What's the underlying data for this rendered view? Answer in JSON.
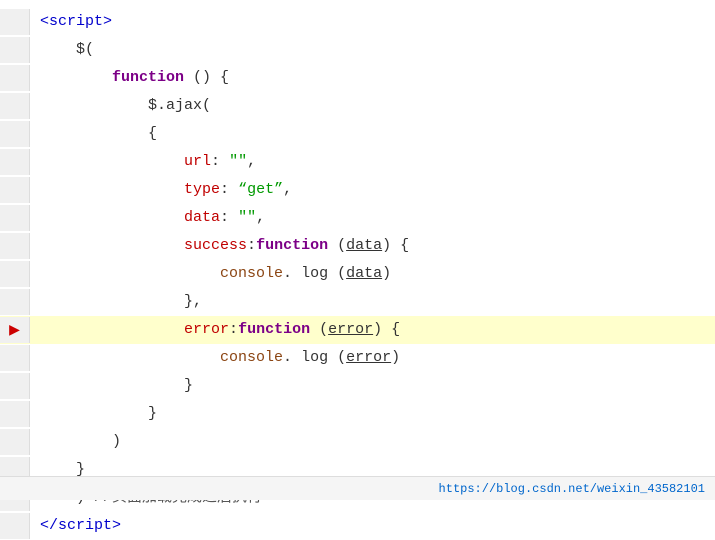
{
  "code": {
    "lines": [
      {
        "id": 1,
        "gutter": "",
        "highlighted": false,
        "parts": [
          {
            "text": "<",
            "class": "tag-bracket"
          },
          {
            "text": "script",
            "class": "tag"
          },
          {
            "text": ">",
            "class": "tag-bracket"
          }
        ]
      },
      {
        "id": 2,
        "gutter": "",
        "highlighted": false,
        "parts": [
          {
            "text": "    $(",
            "class": "plain"
          }
        ]
      },
      {
        "id": 3,
        "gutter": "",
        "highlighted": false,
        "parts": [
          {
            "text": "        ",
            "class": "plain"
          },
          {
            "text": "function",
            "class": "func-kw"
          },
          {
            "text": " () {",
            "class": "plain"
          }
        ]
      },
      {
        "id": 4,
        "gutter": "",
        "highlighted": false,
        "parts": [
          {
            "text": "            $.ajax(",
            "class": "plain"
          }
        ]
      },
      {
        "id": 5,
        "gutter": "",
        "highlighted": false,
        "parts": [
          {
            "text": "            {",
            "class": "plain"
          }
        ]
      },
      {
        "id": 6,
        "gutter": "",
        "highlighted": false,
        "parts": [
          {
            "text": "                ",
            "class": "plain"
          },
          {
            "text": "url",
            "class": "prop"
          },
          {
            "text": ": ",
            "class": "plain"
          },
          {
            "text": "\"\"",
            "class": "str-green"
          },
          {
            "text": ",",
            "class": "plain"
          }
        ]
      },
      {
        "id": 7,
        "gutter": "",
        "highlighted": false,
        "parts": [
          {
            "text": "                ",
            "class": "plain"
          },
          {
            "text": "type",
            "class": "prop"
          },
          {
            "text": ": ",
            "class": "plain"
          },
          {
            "text": "“get”",
            "class": "str-green"
          },
          {
            "text": ",",
            "class": "plain"
          }
        ]
      },
      {
        "id": 8,
        "gutter": "",
        "highlighted": false,
        "parts": [
          {
            "text": "                ",
            "class": "plain"
          },
          {
            "text": "data",
            "class": "prop"
          },
          {
            "text": ": ",
            "class": "plain"
          },
          {
            "text": "\"\"",
            "class": "str-green"
          },
          {
            "text": ",",
            "class": "plain"
          }
        ]
      },
      {
        "id": 9,
        "gutter": "",
        "highlighted": false,
        "parts": [
          {
            "text": "                ",
            "class": "plain"
          },
          {
            "text": "success",
            "class": "prop"
          },
          {
            "text": ":",
            "class": "plain"
          },
          {
            "text": "function",
            "class": "func-kw"
          },
          {
            "text": " (",
            "class": "plain"
          },
          {
            "text": "data",
            "class": "param-underline"
          },
          {
            "text": ") {",
            "class": "plain"
          }
        ]
      },
      {
        "id": 10,
        "gutter": "",
        "highlighted": false,
        "parts": [
          {
            "text": "                    ",
            "class": "plain"
          },
          {
            "text": "console",
            "class": "console-text"
          },
          {
            "text": ".",
            "class": "plain"
          },
          {
            "text": " log",
            "class": "plain"
          },
          {
            "text": " (",
            "class": "plain"
          },
          {
            "text": "data",
            "class": "param-underline"
          },
          {
            "text": ")",
            "class": "plain"
          }
        ]
      },
      {
        "id": 11,
        "gutter": "",
        "highlighted": false,
        "parts": [
          {
            "text": "                },",
            "class": "plain"
          }
        ]
      },
      {
        "id": 12,
        "gutter": "arrow",
        "highlighted": true,
        "parts": [
          {
            "text": "                ",
            "class": "plain"
          },
          {
            "text": "error",
            "class": "prop"
          },
          {
            "text": ":",
            "class": "plain"
          },
          {
            "text": "function",
            "class": "func-kw"
          },
          {
            "text": " (",
            "class": "plain"
          },
          {
            "text": "error",
            "class": "param-underline"
          },
          {
            "text": ") {",
            "class": "plain"
          }
        ]
      },
      {
        "id": 13,
        "gutter": "",
        "highlighted": false,
        "parts": [
          {
            "text": "                    ",
            "class": "plain"
          },
          {
            "text": "console",
            "class": "console-text"
          },
          {
            "text": ".",
            "class": "plain"
          },
          {
            "text": " log",
            "class": "plain"
          },
          {
            "text": " (",
            "class": "plain"
          },
          {
            "text": "error",
            "class": "param-underline"
          },
          {
            "text": ")",
            "class": "plain"
          }
        ]
      },
      {
        "id": 14,
        "gutter": "",
        "highlighted": false,
        "parts": [
          {
            "text": "                }",
            "class": "plain"
          }
        ]
      },
      {
        "id": 15,
        "gutter": "",
        "highlighted": false,
        "parts": [
          {
            "text": "            }",
            "class": "plain"
          }
        ]
      },
      {
        "id": 16,
        "gutter": "",
        "highlighted": false,
        "parts": [
          {
            "text": "        )",
            "class": "plain"
          }
        ]
      },
      {
        "id": 17,
        "gutter": "",
        "highlighted": false,
        "parts": [
          {
            "text": "    }",
            "class": "plain"
          }
        ]
      },
      {
        "id": 18,
        "gutter": "",
        "highlighted": false,
        "parts": [
          {
            "text": "    ) ",
            "class": "plain"
          },
          {
            "text": "//页面加载完成之后执行",
            "class": "comment"
          }
        ]
      },
      {
        "id": 19,
        "gutter": "",
        "highlighted": false,
        "parts": [
          {
            "text": "<",
            "class": "tag-bracket"
          },
          {
            "text": "/script",
            "class": "tag"
          },
          {
            "text": ">",
            "class": "tag-bracket"
          }
        ]
      }
    ]
  },
  "footer": {
    "link_text": "https://blog.csdn.net/weixin_43582101"
  }
}
